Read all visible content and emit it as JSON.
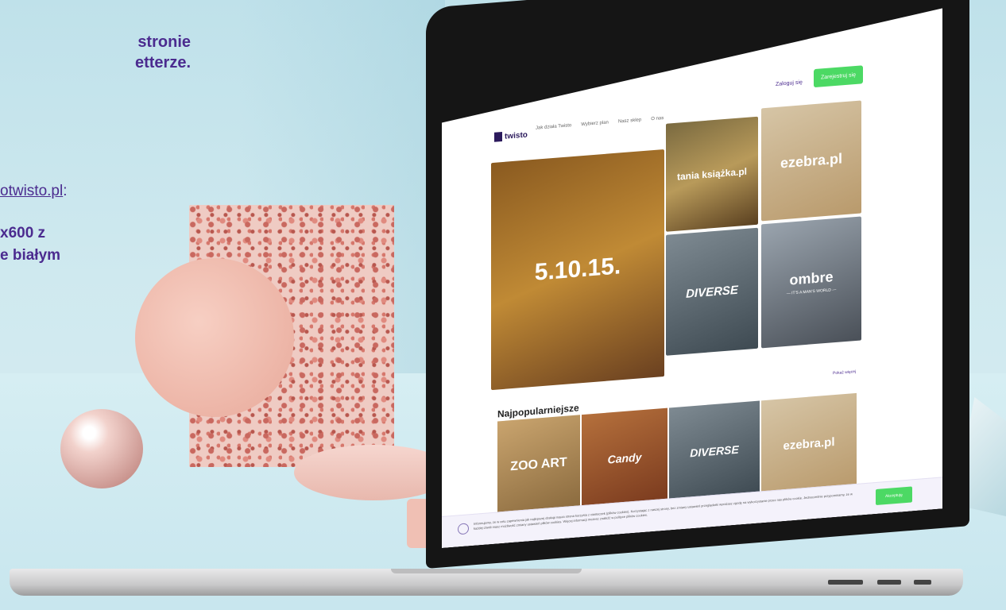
{
  "promo": {
    "line1": "stronie",
    "line2": "etterze.",
    "email_prefix": "",
    "email_link": "otwisto.pl",
    "email_suffix": ":",
    "spec1": "x600 z",
    "spec2": "e białym"
  },
  "site": {
    "brand": "twisto",
    "nav": {
      "items": [
        {
          "label": "Jak działa Twisto"
        },
        {
          "label": "Wybierz plan"
        },
        {
          "label": "Nasz sklep"
        },
        {
          "label": "O nas"
        }
      ],
      "login": "Zaloguj się",
      "register": "Zarejestruj się"
    },
    "featured": {
      "kids": "5.10.15.",
      "tania": "tania książka.pl",
      "ezebra": "ezebra.pl",
      "diverse": "DIVERSE",
      "ombre": "ombre",
      "ombre_tag": "— IT'S A MAN'S WORLD —"
    },
    "popular": {
      "title": "Najpopularniejsze",
      "more": "Pokaż więcej",
      "items": [
        "ZOO ART",
        "Candy",
        "DIVERSE",
        "ezebra.pl"
      ]
    },
    "cookie": {
      "text": "Informujemy, że w celu zapewnienia jak najlepszej obsługi nasza strona korzysta z ciasteczek (plików cookies). Korzystając z naszej strony, bez zmiany ustawień przeglądarki wyrażasz zgodę na wykorzystanie przez nas plików cookie. Jednocześnie przypominamy, że w każdej chwili masz możliwość zmiany ustawień plików cookies. Więcej informacji możesz znaleźć w polityce plików cookies.",
      "accept": "Akceptuję"
    }
  }
}
